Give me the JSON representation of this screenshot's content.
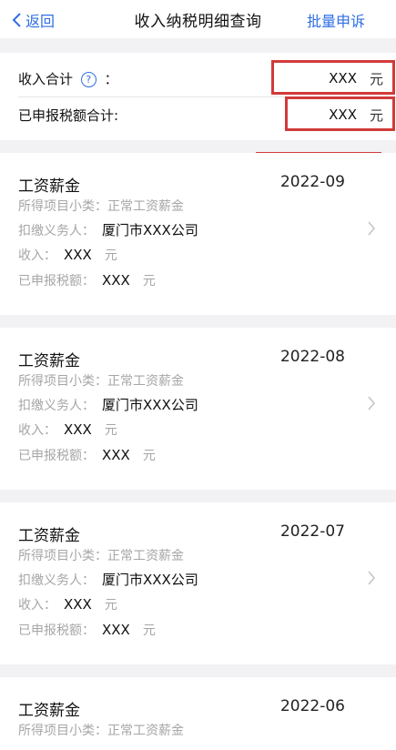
{
  "nav": {
    "back_label": "返回",
    "title": "收入纳税明细查询",
    "right_action": "批量申诉"
  },
  "summary": {
    "income_label": "收入合计",
    "income_colon": "：",
    "income_value": "XXX",
    "income_unit": "元",
    "tax_label": "已申报税额合计:",
    "tax_value": "XXX",
    "tax_unit": "元"
  },
  "records": [
    {
      "title": "工资薪金",
      "date": "2022-09",
      "subcat_label": "所得项目小类：",
      "subcat_value": "正常工资薪金",
      "withholder_label": "扣缴义务人：",
      "withholder_value": "厦门市XXX公司",
      "income_label": "收入：",
      "income_value": "XXX",
      "income_unit": "元",
      "tax_label": "已申报税额：",
      "tax_value": "XXX",
      "tax_unit": "元"
    },
    {
      "title": "工资薪金",
      "date": "2022-08",
      "subcat_label": "所得项目小类：",
      "subcat_value": "正常工资薪金",
      "withholder_label": "扣缴义务人：",
      "withholder_value": "厦门市XXX公司",
      "income_label": "收入：",
      "income_value": "XXX",
      "income_unit": "元",
      "tax_label": "已申报税额：",
      "tax_value": "XXX",
      "tax_unit": "元"
    },
    {
      "title": "工资薪金",
      "date": "2022-07",
      "subcat_label": "所得项目小类：",
      "subcat_value": "正常工资薪金",
      "withholder_label": "扣缴义务人：",
      "withholder_value": "厦门市XXX公司",
      "income_label": "收入：",
      "income_value": "XXX",
      "income_unit": "元",
      "tax_label": "已申报税额：",
      "tax_value": "XXX",
      "tax_unit": "元"
    },
    {
      "title": "工资薪金",
      "date": "2022-06",
      "subcat_label": "所得项目小类：",
      "subcat_value": "正常工资薪金"
    }
  ],
  "colors": {
    "accent": "#2f6fe4",
    "highlight_box": "#d23a3a",
    "muted_text": "#a6a6a6",
    "page_background": "#f2f2f4"
  }
}
